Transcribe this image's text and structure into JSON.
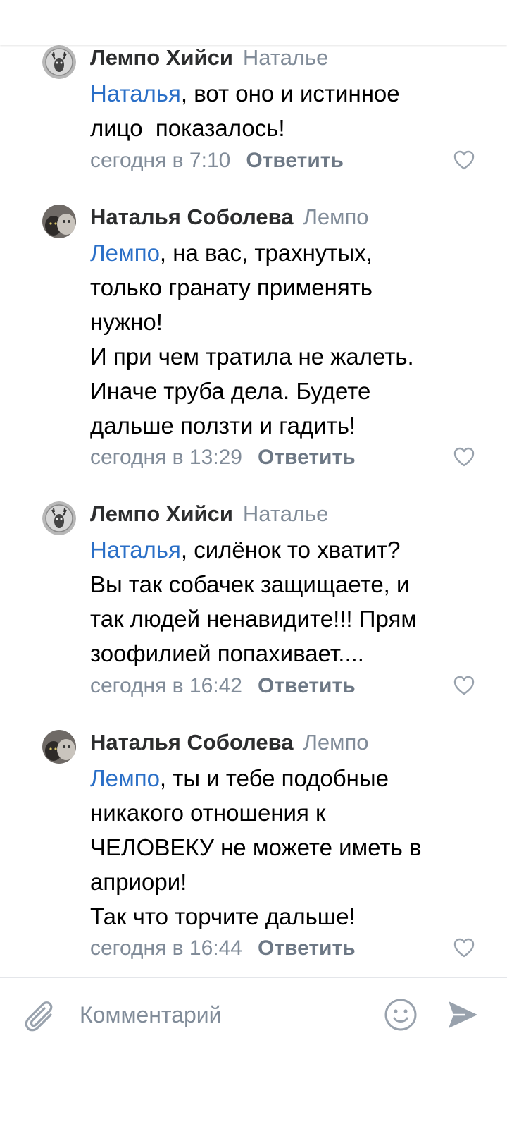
{
  "comments": [
    {
      "author": "Лемпо Хийси",
      "reply_to": "Натальe",
      "mention": "Наталья",
      "text": ", вот оно и истинное\nлицо  показалось!",
      "time": "сегодня в 7:10",
      "reply_label": "Ответить",
      "avatar_icon": "deer-avatar-icon"
    },
    {
      "author": "Наталья Соболева",
      "reply_to": "Лемпо",
      "mention": "Лемпо",
      "text": ", на вас, трахнутых,\nтолько гранату применять\nнужно!\nИ при чем тратила не жалеть.\nИначе труба дела. Будете\nдальше ползти и гадить!",
      "time": "сегодня в 13:29",
      "reply_label": "Ответить",
      "avatar_icon": "cats-avatar-icon"
    },
    {
      "author": "Лемпо Хийси",
      "reply_to": "Натальe",
      "mention": "Наталья",
      "text": ", силёнок то хватит?\nВы так собачек защищаете, и\nтак людей ненавидите!!! Прям\nзоофилией попахивает....",
      "time": "сегодня в 16:42",
      "reply_label": "Ответить",
      "avatar_icon": "deer-avatar-icon"
    },
    {
      "author": "Наталья Соболева",
      "reply_to": "Лемпо",
      "mention": "Лемпо",
      "text": ", ты и тебе подобные\nникакого отношения к\nЧЕЛОВЕКУ не можете иметь в\nаприори!\nТак что торчите дальше!",
      "time": "сегодня в 16:44",
      "reply_label": "Ответить",
      "avatar_icon": "cats-avatar-icon"
    }
  ],
  "composer": {
    "placeholder": "Комментарий",
    "attach_icon": "paperclip-icon",
    "emoji_icon": "smiley-icon",
    "send_icon": "send-arrow-icon"
  },
  "colors": {
    "mention": "#2a6fc7",
    "secondary": "#818c99",
    "author": "#2c2d2e"
  }
}
